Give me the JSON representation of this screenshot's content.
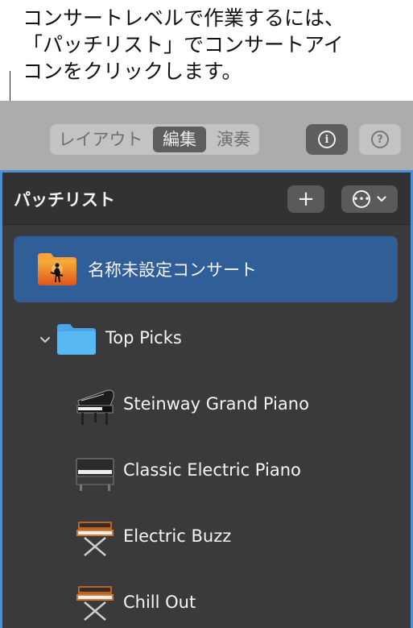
{
  "callout": {
    "lines": [
      "コンサートレベルで作業するには、",
      "「パッチリスト」でコンサートアイ",
      "コンをクリックします。"
    ]
  },
  "toolbar": {
    "segments": [
      "レイアウト",
      "編集",
      "演奏"
    ],
    "active_segment": "編集",
    "info_glyph": "i",
    "help_glyph": "?"
  },
  "patch_list": {
    "title": "パッチリスト",
    "add_glyph": "+",
    "concert": {
      "name": "名称未設定コンサート",
      "icon": "concert-folder-icon",
      "selected": true
    },
    "set": {
      "name": "Top Picks",
      "expanded": true,
      "icon": "folder-icon",
      "patches": [
        {
          "name": "Steinway Grand Piano",
          "icon": "grand-piano-icon"
        },
        {
          "name": "Classic Electric Piano",
          "icon": "electric-piano-icon"
        },
        {
          "name": "Electric Buzz",
          "icon": "synthesizer-icon"
        },
        {
          "name": "Chill Out",
          "icon": "synthesizer-icon"
        }
      ]
    }
  },
  "colors": {
    "panel_bg": "#3a3a3c",
    "selection": "#2f5e98",
    "focus_ring": "#4d8fd6",
    "folder_blue": "#5ab8f5",
    "concert_orange": "#f28a22"
  }
}
